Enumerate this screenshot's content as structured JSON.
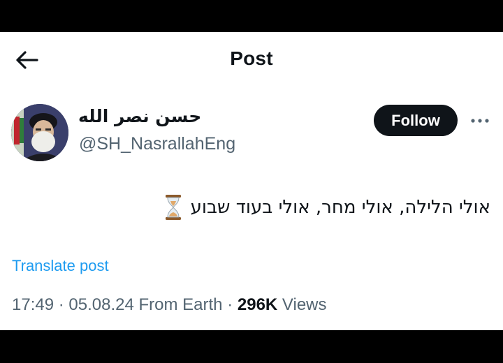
{
  "header": {
    "title": "Post",
    "back_icon": "arrow-left-icon"
  },
  "author": {
    "display_name": "حسن نصر الله",
    "handle": "@SH_NasrallahEng",
    "avatar_icon": "profile-photo"
  },
  "actions": {
    "follow_label": "Follow",
    "more_icon": "more-horizontal-icon"
  },
  "post": {
    "text": "אולי הלילה, אולי מחר, אולי בעוד שבוע",
    "emoji_icon": "hourglass-icon",
    "translate_label": "Translate post"
  },
  "meta": {
    "time": "17:49",
    "separator": "·",
    "date": "05.08.24",
    "location": "From Earth",
    "views_count": "296K",
    "views_label": "Views"
  },
  "colors": {
    "link": "#1d9bf0",
    "secondary_text": "#536471",
    "primary_text": "#0f1419",
    "follow_bg": "#0f1419"
  }
}
